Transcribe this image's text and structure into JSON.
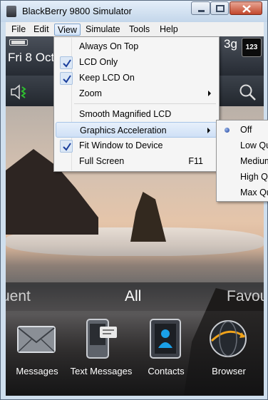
{
  "window": {
    "title": "BlackBerry 9800 Simulator"
  },
  "menubar": {
    "items": [
      "File",
      "Edit",
      "View",
      "Simulate",
      "Tools",
      "Help"
    ],
    "active": "View"
  },
  "view_menu": {
    "items": [
      {
        "label": "Always On Top",
        "checked": false
      },
      {
        "label": "LCD Only",
        "checked": true
      },
      {
        "label": "Keep LCD On",
        "checked": true
      },
      {
        "label": "Zoom",
        "submenu": true
      },
      {
        "label": "Smooth Magnified LCD"
      },
      {
        "label": "Graphics Acceleration",
        "submenu": true,
        "highlighted": true
      },
      {
        "label": "Fit Window to Device",
        "checked": true
      },
      {
        "label": "Full Screen",
        "shortcut": "F11"
      }
    ]
  },
  "graphics_submenu": {
    "items": [
      "Off",
      "Low Qu",
      "Medium",
      "High Qu",
      "Max Qu"
    ],
    "selected": "Off"
  },
  "device": {
    "date": "Fri 8 Oct",
    "network": "3g",
    "notification_badge": "123",
    "tabs": {
      "left": "uent",
      "center": "All",
      "right": "Favou"
    },
    "apps": [
      {
        "label": "Messages",
        "icon": "envelope-icon"
      },
      {
        "label": "Text Messages",
        "icon": "sms-icon"
      },
      {
        "label": "Contacts",
        "icon": "contacts-icon"
      },
      {
        "label": "Browser",
        "icon": "globe-icon"
      }
    ]
  },
  "colors": {
    "menu_highlight": "#cfe0f6",
    "check_blue": "#1b3f9c",
    "title_bar": "#c3d6ea"
  }
}
